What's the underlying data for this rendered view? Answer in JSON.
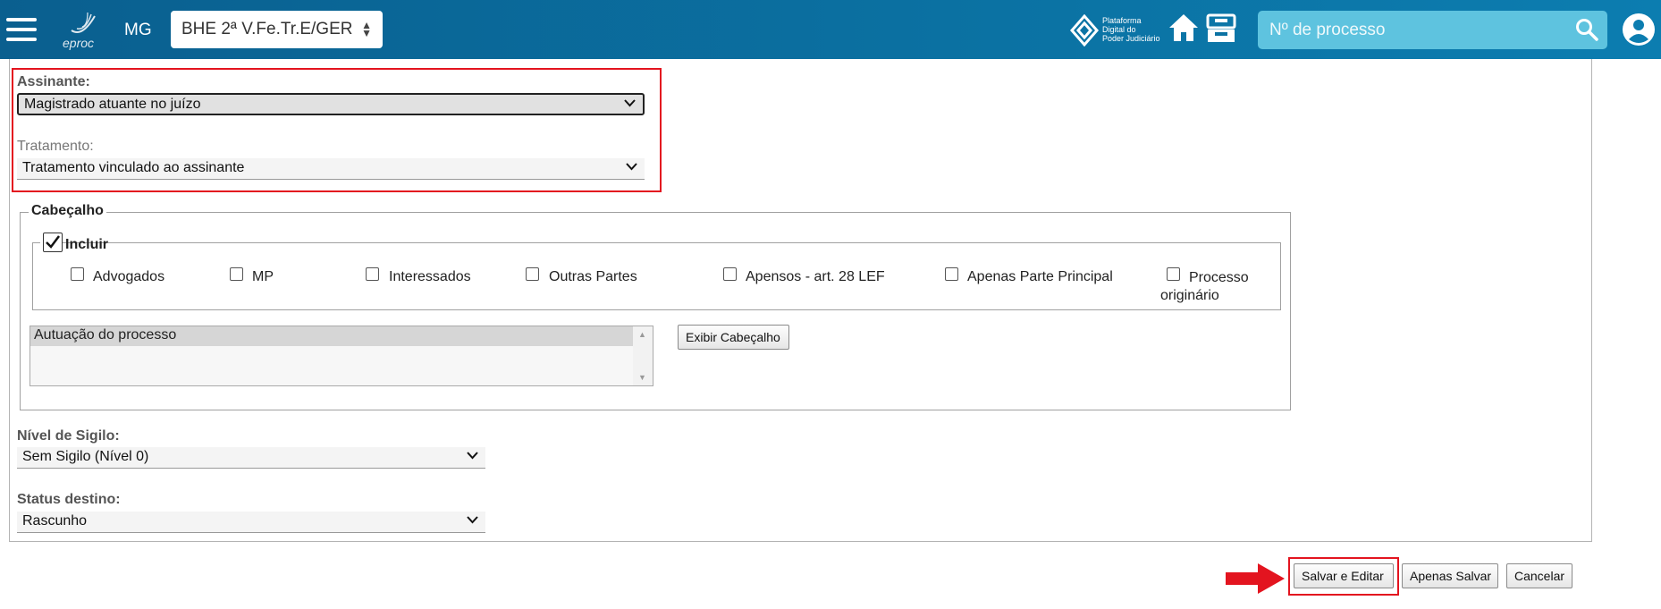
{
  "header": {
    "menu_icon": "hamburger-icon",
    "logo_text": "eproc",
    "uf": "MG",
    "org_select": "BHE 2ª V.Fe.Tr.E/GER",
    "pdpj_text": [
      "Plataforma",
      "Digital do",
      "Poder Judiciário"
    ],
    "search_placeholder": "Nº de processo",
    "home_icon": "home-icon",
    "inbox_icon": "inbox-icon",
    "search_icon": "search-icon",
    "avatar_icon": "user-avatar-icon"
  },
  "form": {
    "assinante_label": "Assinante:",
    "assinante_value": "Magistrado atuante no juízo",
    "tratamento_label": "Tratamento:",
    "tratamento_value": "Tratamento vinculado ao assinante",
    "cabecalho_legend": "Cabeçalho",
    "incluir_label": "Incluir",
    "incluir_checked": true,
    "options": [
      {
        "label": "Advogados",
        "checked": false
      },
      {
        "label": "MP",
        "checked": false
      },
      {
        "label": "Interessados",
        "checked": false
      },
      {
        "label": "Outras Partes",
        "checked": false
      },
      {
        "label": "Apensos - art. 28 LEF",
        "checked": false
      },
      {
        "label": "Apenas Parte Principal",
        "checked": false
      },
      {
        "label": "Processo",
        "label2": "originário",
        "checked": false
      }
    ],
    "cabecalho_list_selected": "Autuação do processo",
    "exibir_button": "Exibir Cabeçalho",
    "sigilo_label": "Nível de Sigilo:",
    "sigilo_value": "Sem Sigilo (Nível 0)",
    "status_label": "Status destino:",
    "status_value": "Rascunho"
  },
  "actions": {
    "salvar_editar": "Salvar e Editar",
    "apenas_salvar": "Apenas Salvar",
    "cancelar": "Cancelar"
  },
  "colors": {
    "topbar": "#0b72a3",
    "search_bg": "#5ec3df",
    "highlight_red": "#e3141f"
  }
}
